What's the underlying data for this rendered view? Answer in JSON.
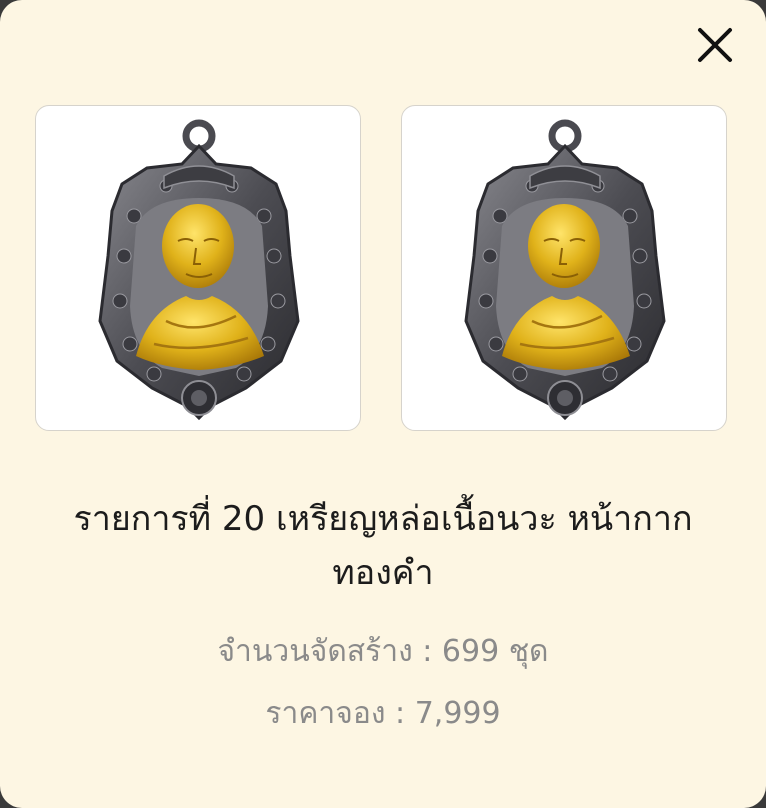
{
  "item": {
    "title": "รายการที่ 20 เหรียญหล่อเนื้อนวะ หน้ากากทองคำ",
    "quantity_text": "จำนวนจัดสร้าง : 699 ชุด",
    "price_text": "ราคาจอง : 7,999"
  },
  "images": [
    {
      "icon": "medal-image"
    },
    {
      "icon": "medal-image"
    }
  ],
  "colors": {
    "background": "#fdf6e3",
    "medal_metal": "#5a5a5e",
    "medal_gold": "#e0b21a"
  }
}
